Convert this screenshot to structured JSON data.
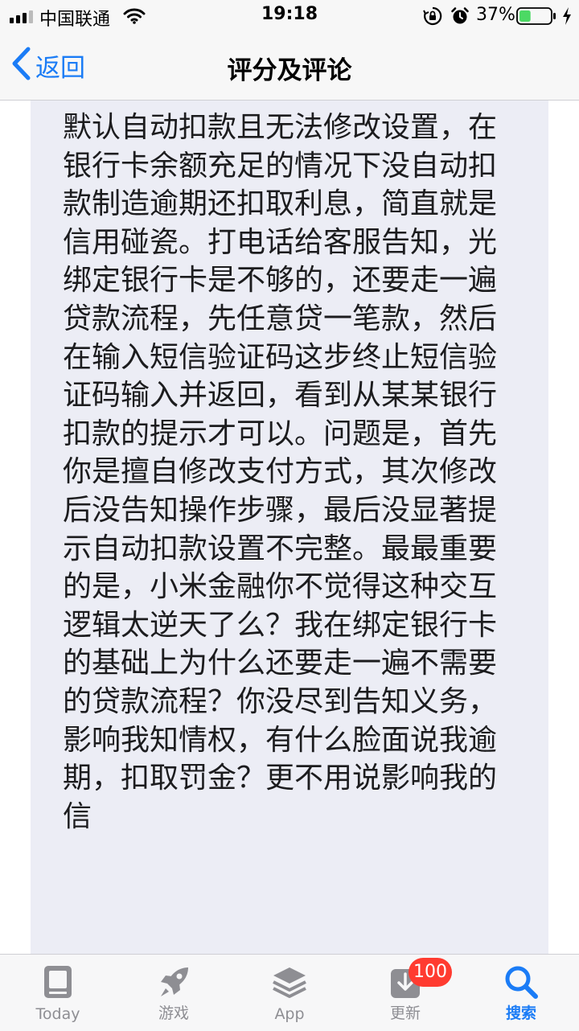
{
  "status_bar": {
    "carrier": "中国联通",
    "time": "19:18",
    "battery_percent": "37%",
    "battery_level": 0.37,
    "icons": [
      "signal-icon",
      "wifi-icon",
      "orientation-lock-icon",
      "alarm-icon",
      "battery-icon",
      "charging-icon"
    ]
  },
  "nav": {
    "back_label": "返回",
    "title": "评分及评论"
  },
  "review": {
    "text": "默认自动扣款且无法修改设置，在银行卡余额充足的情况下没自动扣款制造逾期还扣取利息，简直就是信用碰瓷。打电话给客服告知，光绑定银行卡是不够的，还要走一遍贷款流程，先任意贷一笔款，然后在输入短信验证码这步终止短信验证码输入并返回，看到从某某银行扣款的提示才可以。问题是，首先你是擅自修改支付方式，其次修改后没告知操作步骤，最后没显著提示自动扣款设置不完整。最最重要的是，小米金融你不觉得这种交互逻辑太逆天了么？我在绑定银行卡的基础上为什么还要走一遍不需要的贷款流程？你没尽到告知义务，影响我知情权，有什么脸面说我逾期，扣取罚金？更不用说影响我的信"
  },
  "tabs": [
    {
      "label": "Today",
      "icon": "today-icon"
    },
    {
      "label": "游戏",
      "icon": "rocket-icon"
    },
    {
      "label": "App",
      "icon": "layers-icon"
    },
    {
      "label": "更新",
      "icon": "download-icon",
      "badge": "100"
    },
    {
      "label": "搜索",
      "icon": "search-icon",
      "active": true
    }
  ],
  "colors": {
    "accent": "#1b7cf6",
    "badge": "#ff3b30",
    "card_background": "#ecedf5",
    "inactive_tab": "#8e8e93",
    "battery_fill": "#4cd964"
  }
}
